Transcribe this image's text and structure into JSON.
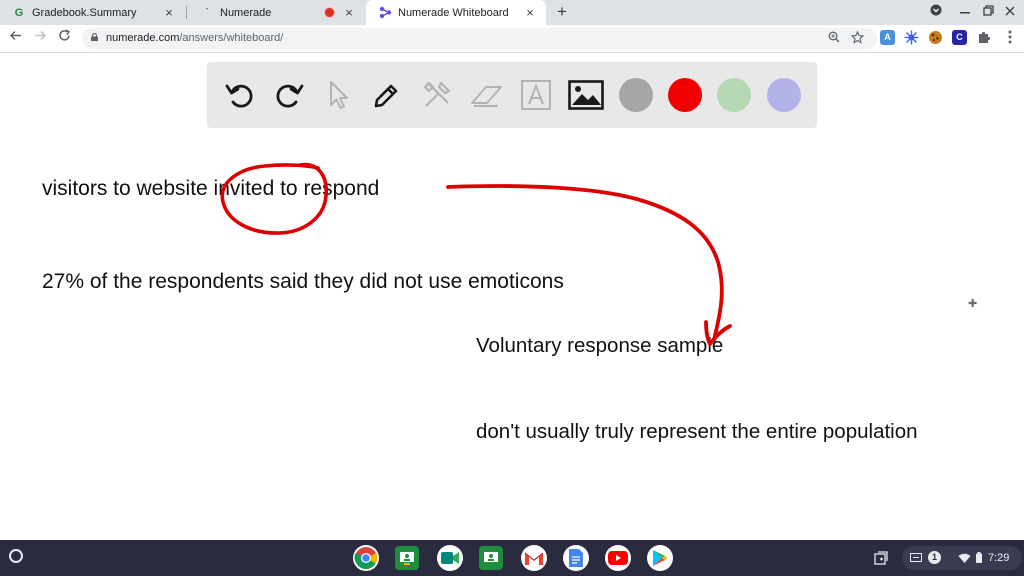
{
  "browser": {
    "tabs": [
      {
        "title": "Gradebook.Summary",
        "favicon": "google-classroom-icon",
        "active": false
      },
      {
        "title": "Numerade",
        "favicon": "numerade-icon",
        "active": false,
        "recording": true
      },
      {
        "title": "Numerade Whiteboard",
        "favicon": "whiteboard-icon",
        "active": true
      }
    ],
    "new_tab_symbol": "+",
    "close_symbol": "×",
    "url_host": "numerade.com",
    "url_path": "/answers/whiteboard/",
    "extensions": [
      "A",
      "C"
    ]
  },
  "whiteboard": {
    "tools": [
      "undo-icon",
      "redo-icon",
      "pointer-icon",
      "pen-icon",
      "tools-icon",
      "eraser-icon",
      "text-icon",
      "image-icon"
    ],
    "colors": [
      "#a6a6a6",
      "#f20000",
      "#b4d9b4",
      "#b3b3ea"
    ],
    "ink_color": "#dd0000",
    "lines": {
      "line1": "visitors to website invited to respond",
      "line2": "27% of the respondents said they did not use emoticons",
      "line3": "Voluntary response sample",
      "line4": "don't usually truly represent the entire population"
    }
  },
  "shelf": {
    "apps": [
      "chrome-icon",
      "classroom-icon",
      "meet-icon",
      "classroom-2-icon",
      "gmail-icon",
      "docs-icon",
      "youtube-icon",
      "play-store-icon"
    ],
    "notification_count": "1",
    "clock": "7:29"
  }
}
